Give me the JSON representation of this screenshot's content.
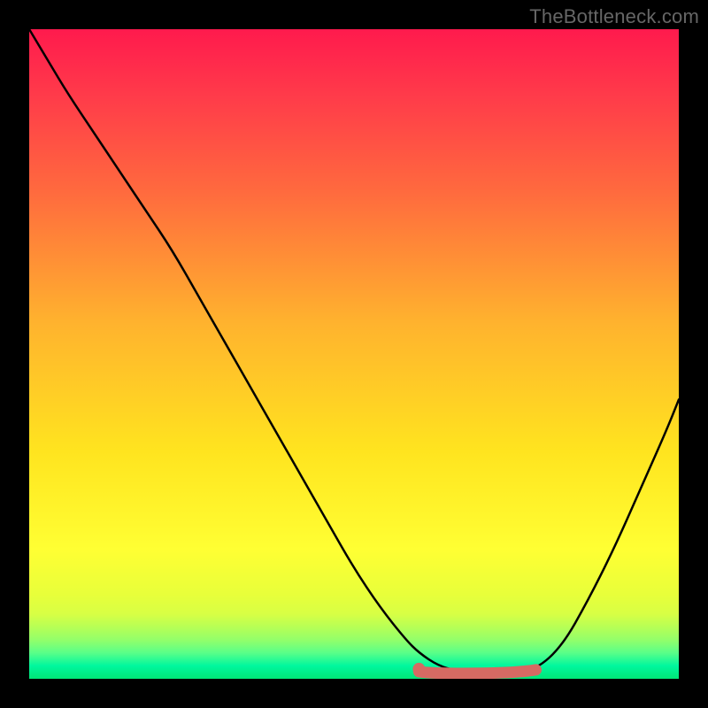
{
  "watermark": "TheBottleneck.com",
  "colors": {
    "curve": "#000000",
    "marker": "#d66a63"
  },
  "chart_data": {
    "type": "line",
    "title": "",
    "xlabel": "",
    "ylabel": "",
    "xlim": [
      0,
      100
    ],
    "ylim": [
      0,
      100
    ],
    "grid": false,
    "series": [
      {
        "name": "curve",
        "x": [
          0,
          3,
          6,
          10,
          14,
          18,
          22,
          26,
          30,
          34,
          38,
          42,
          46,
          50,
          54,
          58,
          60,
          63,
          66,
          70,
          74,
          78,
          82,
          86,
          90,
          94,
          98,
          100
        ],
        "y": [
          100,
          95,
          90,
          84,
          78,
          72,
          66,
          59,
          52,
          45,
          38,
          31,
          24,
          17,
          11,
          6,
          4,
          2,
          1.2,
          1.0,
          1.0,
          1.4,
          5,
          12,
          20,
          29,
          38,
          43
        ]
      }
    ],
    "flat_segment": {
      "x_start": 60,
      "x_end": 78,
      "y": 1.1
    }
  }
}
